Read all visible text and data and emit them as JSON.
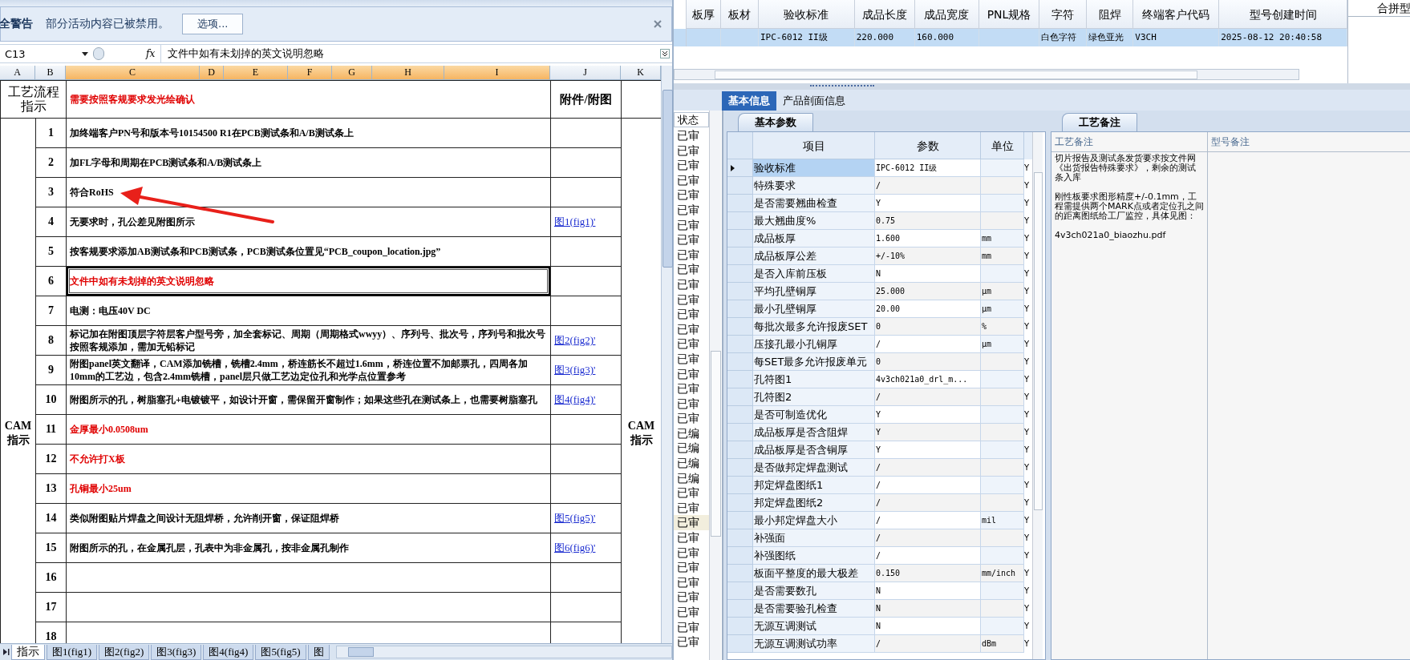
{
  "security_bar": {
    "title": "全警告",
    "message": "部分活动内容已被禁用。",
    "button": "选项..."
  },
  "formula_bar": {
    "cell": "C13",
    "function_label": "fx",
    "formula": "文件中如有未划掉的英文说明忽略"
  },
  "sheet": {
    "columns": [
      "A",
      "B",
      "C",
      "D",
      "E",
      "F",
      "G",
      "H",
      "I",
      "J",
      "K"
    ],
    "corner_heading": "工艺流程指示",
    "instruction_heading": "需要按照客规要求发光绘确认",
    "attachment_heading": "附件/附图",
    "side_label_left": "CAM 指示",
    "side_label_right": "CAM 指示",
    "rows": [
      {
        "no": "1",
        "kind": "normal",
        "selected": false,
        "text": "加终端客户PN号和版本号10154500 R1在PCB测试条和A/B测试条上"
      },
      {
        "no": "2",
        "kind": "normal",
        "selected": false,
        "text": "加FL字母和周期在PCB测试条和A/B测试条上"
      },
      {
        "no": "3",
        "kind": "normal",
        "selected": false,
        "text": "符合RoHS"
      },
      {
        "no": "4",
        "kind": "normal",
        "selected": false,
        "text": "无要求时，孔公差见附图所示",
        "attachment": "图1(fig1)'"
      },
      {
        "no": "5",
        "kind": "normal",
        "selected": false,
        "text": "按客规要求添加AB测试条和PCB测试条，PCB测试条位置见“PCB_coupon_location.jpg”"
      },
      {
        "no": "6",
        "kind": "warning",
        "selected": true,
        "text": "文件中如有未划掉的英文说明忽略"
      },
      {
        "no": "7",
        "kind": "normal",
        "selected": false,
        "text": "电测：电压40V DC"
      },
      {
        "no": "8",
        "kind": "normal",
        "selected": false,
        "text": "标记加在附图顶层字符层客户型号旁，加全套标记、周期（周期格式wwyy）、序列号、批次号，序列号和批次号按照客规添加，需加无铅标记",
        "attachment": "图2(fig2)'"
      },
      {
        "no": "9",
        "kind": "normal",
        "selected": false,
        "text": "附图panel英文翻译，CAM添加铣槽，铣槽2.4mm，桥连筋长不超过1.6mm，桥连位置不加邮票孔，四周各加10mm的工艺边，包含2.4mm铣槽，panel层只做工艺边定位孔和光学点位置参考",
        "attachment": "图3(fig3)'"
      },
      {
        "no": "10",
        "kind": "normal",
        "selected": false,
        "text": "附图所示的孔，树脂塞孔+电镀镀平，如设计开窗，需保留开窗制作；如果这些孔在测试条上，也需要树脂塞孔",
        "attachment": "图4(fig4)'"
      },
      {
        "no": "11",
        "kind": "warning",
        "selected": false,
        "text": "金厚最小0.0508um"
      },
      {
        "no": "12",
        "kind": "warning",
        "selected": false,
        "text": "不允许打X板"
      },
      {
        "no": "13",
        "kind": "warning",
        "selected": false,
        "text": "孔铜最小25um"
      },
      {
        "no": "14",
        "kind": "normal",
        "selected": false,
        "text": "类似附图贴片焊盘之间设计无阻焊桥，允许削开窗，保证阻焊桥",
        "attachment": "图5(fig5)'"
      },
      {
        "no": "15",
        "kind": "normal",
        "selected": false,
        "text": "附图所示的孔，在金属孔层，孔表中为非金属孔，按非金属孔制作",
        "attachment": "图6(fig6)'"
      },
      {
        "no": "16",
        "kind": "normal",
        "selected": false
      },
      {
        "no": "17",
        "kind": "normal",
        "selected": false
      },
      {
        "no": "18",
        "kind": "normal",
        "selected": false
      }
    ]
  },
  "sheet_tabs": [
    {
      "label": "指示",
      "selected": true
    },
    {
      "label": "图1(fig1)",
      "selected": false
    },
    {
      "label": "图2(fig2)",
      "selected": false
    },
    {
      "label": "图3(fig3)",
      "selected": false
    },
    {
      "label": "图4(fig4)",
      "selected": false
    },
    {
      "label": "图5(fig5)",
      "selected": false
    },
    {
      "label": "图",
      "selected": false
    }
  ],
  "order_grid": {
    "row_selected": true,
    "columns": [
      {
        "label": "板厚"
      },
      {
        "label": "板材"
      },
      {
        "label": "验收标准",
        "value": "IPC-6012 II级"
      },
      {
        "label": "成品长度",
        "value": "220.000"
      },
      {
        "label": "成品宽度",
        "value": "160.000"
      },
      {
        "label": "PNL规格"
      },
      {
        "label": "字符",
        "value": "白色字符"
      },
      {
        "label": "阻焊",
        "value": "绿色亚光"
      },
      {
        "label": "终端客户代码",
        "value": "V3CH"
      },
      {
        "label": "型号创建时间",
        "value": "2025-08-12 20:40:58"
      }
    ]
  },
  "merge_panel": {
    "header": "合拼型"
  },
  "detail_tabs": [
    {
      "label": "基本信息",
      "selected": true
    },
    {
      "label": "产品剖面信息",
      "selected": false
    }
  ],
  "status_list": {
    "header": "状态",
    "items": [
      {
        "label": "已审",
        "selected": false
      },
      {
        "label": "已审",
        "selected": false
      },
      {
        "label": "已审",
        "selected": false
      },
      {
        "label": "已审",
        "selected": false
      },
      {
        "label": "已审",
        "selected": false
      },
      {
        "label": "已审",
        "selected": false
      },
      {
        "label": "已审",
        "selected": false
      },
      {
        "label": "已审",
        "selected": false
      },
      {
        "label": "已审",
        "selected": false
      },
      {
        "label": "已审",
        "selected": false
      },
      {
        "label": "已审",
        "selected": false
      },
      {
        "label": "已审",
        "selected": false
      },
      {
        "label": "已审",
        "selected": false
      },
      {
        "label": "已审",
        "selected": false
      },
      {
        "label": "已审",
        "selected": false
      },
      {
        "label": "已审",
        "selected": false
      },
      {
        "label": "已审",
        "selected": false
      },
      {
        "label": "已审",
        "selected": false
      },
      {
        "label": "已审",
        "selected": false
      },
      {
        "label": "已审",
        "selected": false
      },
      {
        "label": "已编",
        "selected": false
      },
      {
        "label": "已编",
        "selected": false
      },
      {
        "label": "已编",
        "selected": false
      },
      {
        "label": "已编",
        "selected": false
      },
      {
        "label": "已审",
        "selected": false
      },
      {
        "label": "已审",
        "selected": false
      },
      {
        "label": "已审",
        "selected": true
      },
      {
        "label": "已审",
        "selected": false
      },
      {
        "label": "已审",
        "selected": false
      },
      {
        "label": "已审",
        "selected": false
      },
      {
        "label": "已审",
        "selected": false
      },
      {
        "label": "已审",
        "selected": false
      },
      {
        "label": "已审",
        "selected": false
      },
      {
        "label": "已审",
        "selected": false
      },
      {
        "label": "已审",
        "selected": false
      }
    ]
  },
  "params": {
    "tab": "基本参数",
    "columns": [
      "项目",
      "参数",
      "单位"
    ],
    "rows": [
      {
        "item": "验收标准",
        "value": "IPC-6012 II级",
        "flag": "Y",
        "selected": true
      },
      {
        "item": "特殊要求",
        "value": "/",
        "flag": "Y",
        "selected": false
      },
      {
        "item": "是否需要翘曲检查",
        "value": "Y",
        "flag": "Y",
        "selected": false
      },
      {
        "item": "最大翘曲度%",
        "value": "0.75",
        "flag": "Y",
        "selected": false
      },
      {
        "item": "成品板厚",
        "value": "1.600",
        "unit": "mm",
        "flag": "Y",
        "selected": false
      },
      {
        "item": "成品板厚公差",
        "value": "+/-10%",
        "unit": "mm",
        "flag": "Y",
        "selected": false
      },
      {
        "item": "是否入库前压板",
        "value": "N",
        "flag": "Y",
        "selected": false
      },
      {
        "item": "平均孔壁铜厚",
        "value": "25.000",
        "unit": "μm",
        "flag": "Y",
        "selected": false
      },
      {
        "item": "最小孔壁铜厚",
        "value": "20.00",
        "unit": "μm",
        "flag": "Y",
        "selected": false
      },
      {
        "item": "每批次最多允许报废SET",
        "value": "0",
        "unit": "%",
        "flag": "Y",
        "selected": false
      },
      {
        "item": "压接孔最小孔铜厚",
        "value": "/",
        "unit": "μm",
        "flag": "Y",
        "selected": false
      },
      {
        "item": "每SET最多允许报废单元",
        "value": "0",
        "flag": "Y",
        "selected": false
      },
      {
        "item": "孔符图1",
        "value": "4v3ch021a0_drl_m...",
        "flag": "Y",
        "selected": false
      },
      {
        "item": "孔符图2",
        "value": "/",
        "flag": "Y",
        "selected": false
      },
      {
        "item": "是否可制造优化",
        "value": "Y",
        "flag": "Y",
        "selected": false
      },
      {
        "item": "成品板厚是否含阻焊",
        "value": "Y",
        "flag": "Y",
        "selected": false
      },
      {
        "item": "成品板厚是否含铜厚",
        "value": "Y",
        "flag": "Y",
        "selected": false
      },
      {
        "item": "是否做邦定焊盘测试",
        "value": "/",
        "flag": "Y",
        "selected": false
      },
      {
        "item": "邦定焊盘图纸1",
        "value": "/",
        "flag": "Y",
        "selected": false
      },
      {
        "item": "邦定焊盘图纸2",
        "value": "/",
        "flag": "Y",
        "selected": false
      },
      {
        "item": "最小邦定焊盘大小",
        "value": "/",
        "unit": "mil",
        "flag": "Y",
        "selected": false
      },
      {
        "item": "补强面",
        "value": "/",
        "flag": "Y",
        "selected": false
      },
      {
        "item": "补强图纸",
        "value": "/",
        "flag": "Y",
        "selected": false
      },
      {
        "item": "板面平整度的最大极差",
        "value": "0.150",
        "unit": "mm/inch",
        "flag": "Y",
        "selected": false
      },
      {
        "item": "是否需要数孔",
        "value": "N",
        "flag": "Y",
        "selected": false
      },
      {
        "item": "是否需要验孔检查",
        "value": "N",
        "flag": "Y",
        "selected": false
      },
      {
        "item": "无源互调测试",
        "value": "N",
        "flag": "Y",
        "selected": false
      },
      {
        "item": "无源互调测试功率",
        "value": "/",
        "unit": "dBm",
        "flag": "Y",
        "selected": false
      }
    ]
  },
  "notes": {
    "tab": "工艺备注",
    "columns": [
      "工艺备注",
      "型号备注"
    ],
    "paragraphs": [
      "切片报告及测试条发货要求按文件网《出货报告特殊要求》，剩余的测试条入库",
      "刚性板要求图形精度+/-0.1mm，工程需提供两个MARK点或者定位孔之间的距离图纸给工厂监控，具体见图：",
      "4v3ch021a0_biaozhu.pdf"
    ]
  }
}
